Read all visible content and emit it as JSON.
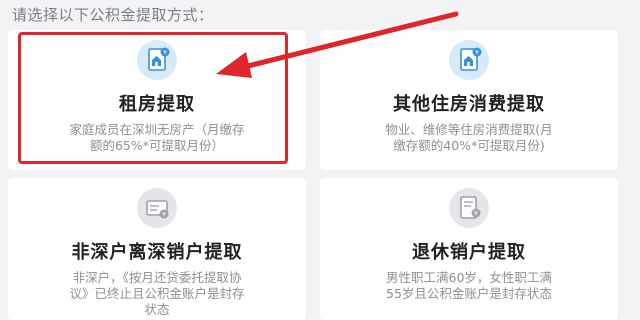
{
  "instruction": "请选择以下公积金提取方式：",
  "options": [
    {
      "title": "租房提取",
      "description": "家庭成员在深圳无房产（月缴存额的65%*可提取月份）",
      "icon": "rent-house-icon"
    },
    {
      "title": "其他住房消费提取",
      "description": "物业、维修等住房消费提取(月缴存额的40%*可提取月份)",
      "icon": "housing-consumption-icon"
    },
    {
      "title": "非深户离深销户提取",
      "description": "非深户，《按月还贷委托提取协议》已终止且公积金账户是封存状态",
      "icon": "non-shenzhen-account-icon"
    },
    {
      "title": "退休销户提取",
      "description": "男性职工满60岁，女性职工满55岁且公积金账户是封存状态",
      "icon": "retirement-icon"
    }
  ],
  "colors": {
    "highlight": "#e0262a",
    "icon_active_bg": "#d6eaf9",
    "icon_active_fg": "#3b8fd9",
    "icon_inactive_bg": "#e4e6e9",
    "icon_inactive_fg": "#9ea3a9"
  }
}
